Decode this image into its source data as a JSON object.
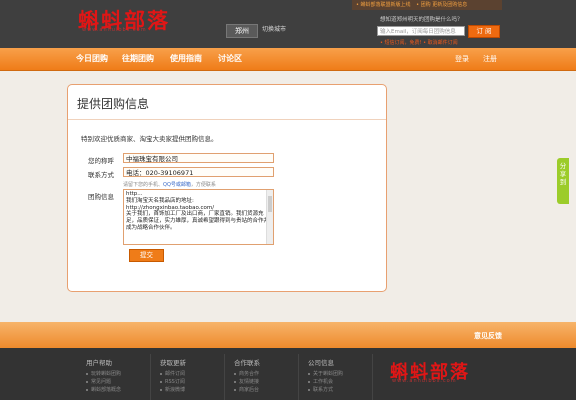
{
  "header": {
    "logo_text": "蝌蚪部落",
    "logo_url": "www.anhuibbs.com",
    "city": "郑州",
    "switch_city": "切换城市",
    "notice": [
      "• 蝌蚪部落联盟新版上线",
      "• 团购 更新及团购信息"
    ],
    "subscribe_prompt": "想知道郑州明天的团购是什么吗？",
    "email_placeholder": "输入Email，订阅每日团购信息",
    "subscribe_button": "订 阅",
    "links": [
      "• 短信订阅，免费!",
      "• 取消邮件订阅"
    ]
  },
  "nav": {
    "items": [
      "今日团购",
      "往期团购",
      "使用指南",
      "讨论区"
    ],
    "login": "登录",
    "register": "注册"
  },
  "form": {
    "title": "提供团购信息",
    "intro": "特别欢迎优质商家、淘宝大卖家提供团购信息。",
    "name_label": "您的称呼",
    "name_value": "中福珠宝有限公司",
    "contact_label": "联系方式",
    "contact_value": "电话：020-39106971",
    "contact_hint_prefix": "请留下您的手机、",
    "contact_hint_link": "QQ号或邮箱",
    "contact_hint_suffix": "，方便联系",
    "info_label": "团购信息",
    "info_lines": [
      "http...",
      "我们淘宝天名我品店的地址:",
      "http://zhongxinbao.taobao.com/",
      "关于我们，首饰加工厂及出口商，厂家直销。我们货源充足，品质保证，实力雄厚，真诚希望跟得到与贵站的合作并成为战略合作伙伴。"
    ],
    "submit": "提交"
  },
  "side_tab": "分享到",
  "feedback": "意见反馈",
  "footer": {
    "columns": [
      {
        "title": "用户帮助",
        "items": [
          "玩转蝌蚪团购",
          "常见问题",
          "蝌蚪部落概念"
        ]
      },
      {
        "title": "获取更新",
        "items": [
          "邮件订阅",
          "RSS订阅",
          "新浪微博"
        ]
      },
      {
        "title": "合作联系",
        "items": [
          "商务合作",
          "友情链接",
          "商家后台"
        ]
      },
      {
        "title": "公司信息",
        "items": [
          "关于蝌蚪团购",
          "工作机会",
          "联系方式"
        ]
      }
    ],
    "logo_text": "蝌蚪部落",
    "logo_url": "www.anhuibbs.com"
  },
  "colors": {
    "accent": "#ef7c18",
    "logo_red": "#e01616",
    "dark": "#3f3f3f"
  }
}
